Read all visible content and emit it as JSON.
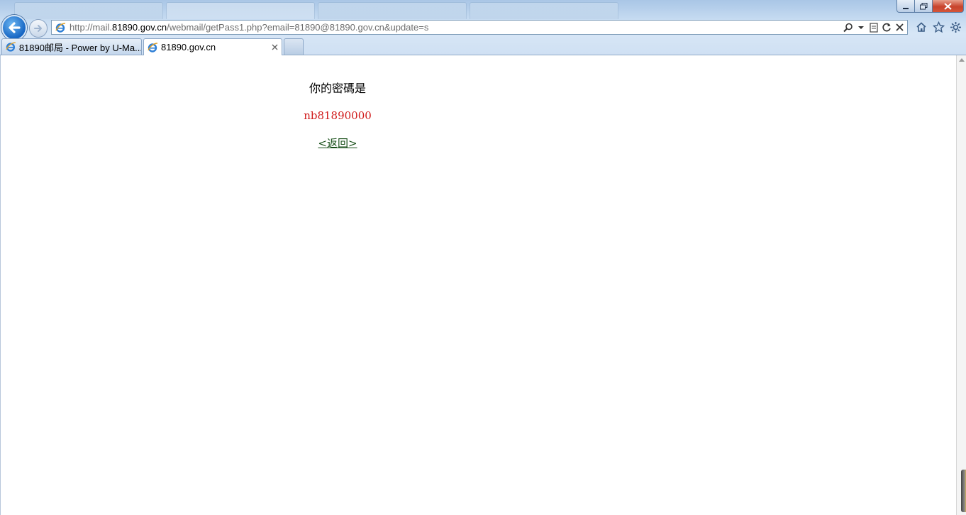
{
  "browser": {
    "address_url_prefix": "http://mail.",
    "address_url_domain": "81890.gov.cn",
    "address_url_path": "/webmail/getPass1.php?email=81890@81890.gov.cn&update=s"
  },
  "tabs": [
    {
      "label": "81890邮局 - Power by U-Ma...",
      "active": false
    },
    {
      "label": "81890.gov.cn",
      "active": true
    }
  ],
  "page": {
    "message": "你的密碼是",
    "password": "nb81890000",
    "back_link": "<返回>"
  },
  "colors": {
    "password": "#d01a1a",
    "link": "#154d16"
  }
}
